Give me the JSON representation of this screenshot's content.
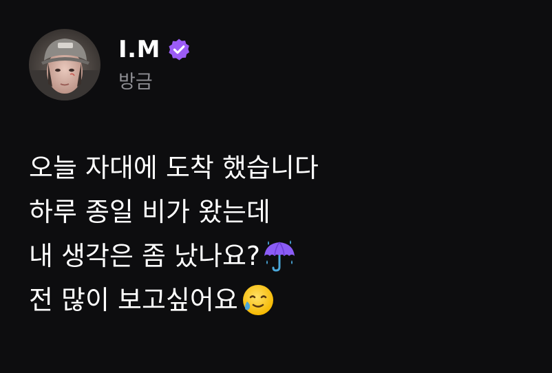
{
  "post": {
    "author": {
      "name": "I.M",
      "verified": true,
      "verified_badge_color": "#9b5cf6"
    },
    "timestamp": "방금",
    "lines": [
      {
        "text": "오늘 자대에 도착 했습니다",
        "emoji": null
      },
      {
        "text": "하루 종일 비가 왔는데",
        "emoji": null
      },
      {
        "text": "내 생각은 좀 났나요?",
        "emoji": "umbrella-with-rain-icon"
      },
      {
        "text": "전 많이 보고싶어요",
        "emoji": "smiling-face-with-tear-icon"
      }
    ]
  },
  "colors": {
    "background": "#0d0d0f",
    "text": "#ffffff",
    "muted": "#8e8e93",
    "accent": "#9b5cf6"
  }
}
